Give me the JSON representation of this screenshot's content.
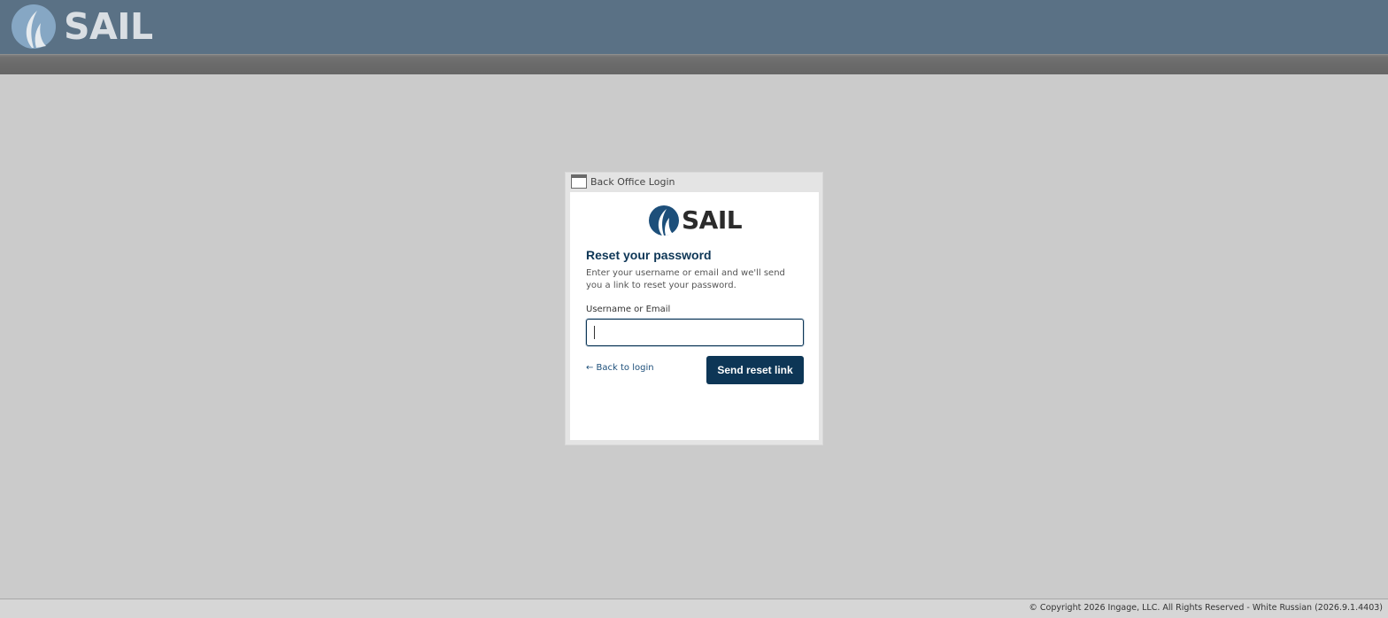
{
  "header": {
    "logo_icon": "sail-logo-icon",
    "logo_text": "SAIL",
    "background_color": "#5a7185"
  },
  "dialog": {
    "window_icon": "window-icon",
    "title": "Back Office Login",
    "brand_text": "SAIL",
    "heading": "Reset your password",
    "description": "Enter your username or email and we'll send you a link to reset your password.",
    "field_label": "Username or Email",
    "field_value": "",
    "back_link": "← Back to login",
    "submit_label": "Send reset link",
    "accent_color": "#0d3656"
  },
  "footer": {
    "text": "© Copyright 2026 Ingage, LLC. All Rights Reserved - White Russian (2026.9.1.4403)"
  }
}
